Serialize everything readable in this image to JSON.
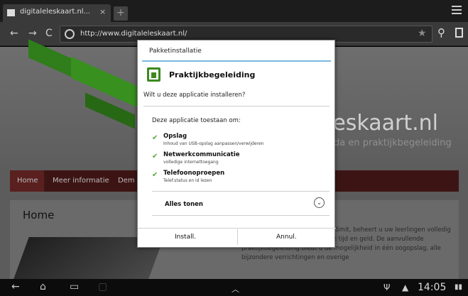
{
  "browser": {
    "tab_title": "digitaleleskaart.nl...",
    "tab_close": "×",
    "new_tab": "+",
    "url": "http://www.digitaleleskaart.nl/",
    "icons": [
      "back-arrow-icon",
      "forward-arrow-icon",
      "reload-icon",
      "globe-icon",
      "star-icon",
      "search-icon",
      "bookmarks-icon",
      "menu-icon"
    ]
  },
  "website": {
    "title": "leskaart.nl",
    "subtitle": "da en praktijkbegeleiding",
    "nav": [
      "Home",
      "Meer informatie",
      "Dem"
    ],
    "content_title": "Home",
    "content_text": "ktijkbegeleiding van Uitgeverij Smit, beheert u uw leerlingen volledig digitaal en bespaart u daarmee tijd en geld. De aanvullende praktijkbegeleiding biedt u de mogelijkheid in één oogopslag, alle bijzondere verrichtingen en overige"
  },
  "dialog": {
    "title": "Pakketinstallatie",
    "app_name": "Praktijkbegeleiding",
    "question": "Wilt u deze applicatie installeren?",
    "permissions_heading": "Deze applicatie toestaan om:",
    "permissions": [
      {
        "title": "Opslag",
        "desc": "Inhoud van USB-opslag aanpassen/verwijderen"
      },
      {
        "title": "Netwerkcommunicatie",
        "desc": "volledige internettoegang"
      },
      {
        "title": "Telefoonoproepen",
        "desc": "Telef.status en id lezen"
      }
    ],
    "show_all": "Alles tonen",
    "install_label": "Install.",
    "cancel_label": "Annul.",
    "check_glyph": "✔"
  },
  "system_bar": {
    "time": "14:05",
    "icons": [
      "back-icon",
      "home-icon",
      "recent-apps-icon",
      "screenshot-icon",
      "up-chevron-icon",
      "usb-icon",
      "warning-icon",
      "battery-icon"
    ]
  },
  "colors": {
    "accent_blue": "#7ab8e0",
    "app_green": "#3d8a1e",
    "nav_maroon": "#3d1414"
  }
}
